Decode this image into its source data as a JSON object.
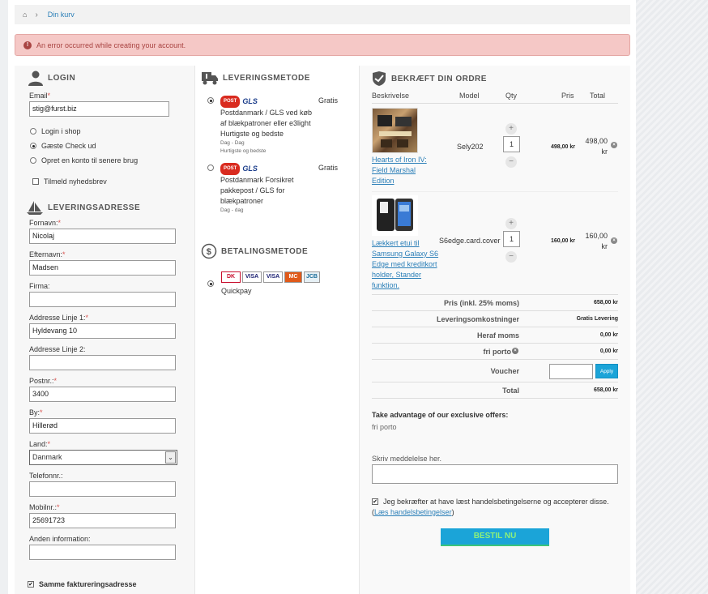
{
  "breadcrumb": {
    "current": "Din kurv"
  },
  "alert": {
    "message": "An error occurred while creating your account."
  },
  "login": {
    "title": "LOGIN",
    "email_label": "Email",
    "email_value": "stig@furst.biz",
    "options": [
      "Login i shop",
      "Gæste Check ud",
      "Opret en konto til senere brug"
    ],
    "selected_option": 1,
    "newsletter_label": "Tilmeld nyhedsbrev"
  },
  "delivery": {
    "title": "LEVERINGSADRESSE",
    "fields": [
      {
        "label": "Fornavn:",
        "required": true,
        "value": "Nicolaj"
      },
      {
        "label": "Efternavn:",
        "required": true,
        "value": "Madsen"
      },
      {
        "label": "Firma:",
        "required": false,
        "value": ""
      },
      {
        "label": "Addresse Linje 1:",
        "required": true,
        "value": "Hyldevang 10"
      },
      {
        "label": "Addresse Linje 2:",
        "required": false,
        "value": ""
      },
      {
        "label": "Postnr.:",
        "required": true,
        "value": "3400"
      },
      {
        "label": "By:",
        "required": true,
        "value": "Hillerød"
      },
      {
        "label": "Land:",
        "required": true,
        "value": "Danmark"
      },
      {
        "label": "Telefonnr.:",
        "required": false,
        "value": ""
      },
      {
        "label": "Mobilnr.:",
        "required": true,
        "value": "25691723"
      },
      {
        "label": "Anden information:",
        "required": false,
        "value": ""
      }
    ],
    "same_billing_label": "Samme faktureringsadresse"
  },
  "shipping": {
    "title": "LEVERINGSMETODE",
    "options": [
      {
        "name": "Postdanmark / GLS ved køb af blækpatroner eller e3light Hurtigste og bedste",
        "price": "Gratis",
        "note1": "Dag - Dag",
        "note2": "Hurtigste og bedste",
        "selected": true
      },
      {
        "name": "Postdanmark Forsikret pakkepost / GLS for blækpatroner",
        "price": "Gratis",
        "note1": "Dag - dag",
        "note2": "",
        "selected": false
      }
    ],
    "logo_post": "POST",
    "logo_gls": "GLS"
  },
  "payment": {
    "title": "BETALINGSMETODE",
    "method": "Quickpay",
    "logos": [
      "DK",
      "VISA",
      "VISA",
      "MC",
      "JCB"
    ]
  },
  "order": {
    "title": "BEKRÆFT DIN ORDRE",
    "headers": {
      "desc": "Beskrivelse",
      "model": "Model",
      "qty": "Qty",
      "price": "Pris",
      "total": "Total"
    },
    "items": [
      {
        "name": "Hearts of Iron IV: Field Marshal Edition",
        "model": "Sely202",
        "qty": "1",
        "price": "498,00 kr",
        "total": "498,00 kr"
      },
      {
        "name": "Lækkert etui til Samsung Galaxy S6 Edge med kreditkort holder, Stander funktion.",
        "model": "S6edge.card.cover",
        "qty": "1",
        "price": "160,00 kr",
        "total": "160,00 kr"
      }
    ],
    "summary": [
      {
        "label": "Pris (inkl. 25% moms)",
        "value": "658,00 kr"
      },
      {
        "label": "Leveringsomkostninger",
        "value": "Gratis Levering"
      },
      {
        "label": "Heraf moms",
        "value": "0,00 kr"
      },
      {
        "label": "fri porto",
        "value": "0,00 kr"
      }
    ],
    "voucher_label": "Voucher",
    "apply_label": "Apply",
    "total_label": "Total",
    "total_value": "658,00 kr",
    "offers_title": "Take advantage of our exclusive offers:",
    "offers_text": "fri porto",
    "message_label": "Skriv meddelelse her.",
    "terms_text": "Jeg bekræfter at have læst handelsbetingelserne og accepterer disse.",
    "terms_link": "Læs handelsbetingelser",
    "submit_label": "BESTIL NU"
  },
  "colors": {
    "accent": "#1ba4d8",
    "error_bg": "#f5c8c6",
    "link": "#2b7fb8"
  }
}
